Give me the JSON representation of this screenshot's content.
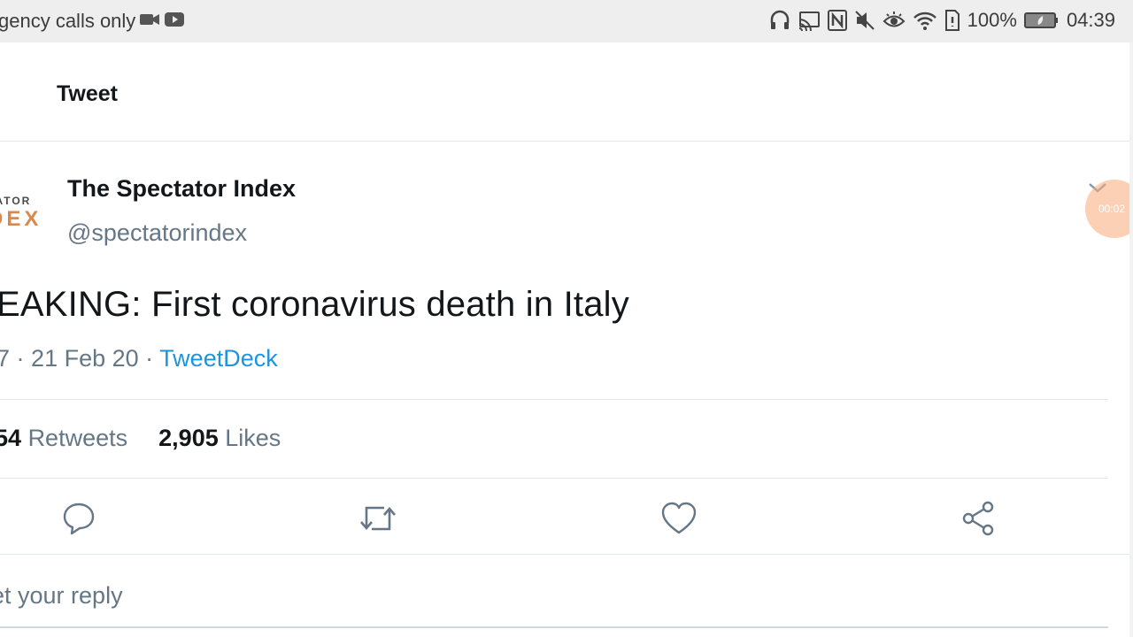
{
  "status_bar": {
    "left_text": "gency calls only",
    "left_icons": [
      "video-camera-icon",
      "youtube-icon"
    ],
    "right_icons": [
      "headphones-icon",
      "cast-icon",
      "nfc-icon",
      "mute-icon",
      "eye-comfort-icon",
      "wifi-icon",
      "sim-icon"
    ],
    "battery_percent": "100%",
    "time": "04:39"
  },
  "header": {
    "title": "Tweet"
  },
  "tweet": {
    "avatar_text_top": "TATOR",
    "avatar_text_bottom": "DEX",
    "display_name": "The Spectator Index",
    "handle": "@spectatorindex",
    "text": "EAKING: First coronavirus death in Italy",
    "time_fragment": "7",
    "date": "21 Feb 20",
    "source": "TweetDeck",
    "retweet_count_fragment": "54",
    "retweets_label": "Retweets",
    "likes_count": "2,905",
    "likes_label": "Likes"
  },
  "recorder": {
    "timer": "00:02"
  },
  "actions": {
    "reply": "reply-icon",
    "retweet": "retweet-icon",
    "like": "heart-icon",
    "share": "share-icon"
  },
  "reply_box": {
    "placeholder": "et your reply"
  },
  "colors": {
    "link": "#1b95e0",
    "secondary_text": "#657786",
    "brand_orange": "#d9894d"
  }
}
